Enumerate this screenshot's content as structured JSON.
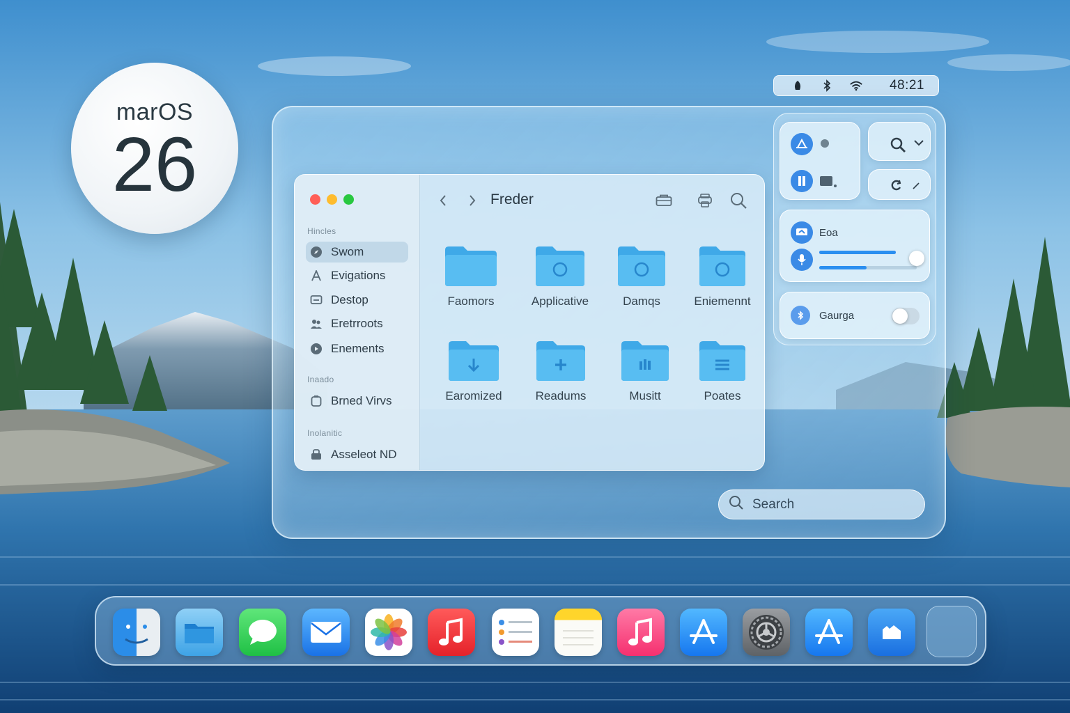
{
  "badge": {
    "title": "marOS",
    "version": "26"
  },
  "menubar": {
    "icons": [
      "focus-icon",
      "bluetooth-icon",
      "wifi-icon"
    ],
    "clock": "48:21"
  },
  "finder": {
    "title": "Freder",
    "sidebar": {
      "sections": [
        {
          "title": "Hincles",
          "items": [
            {
              "label": "Swom",
              "icon": "compass-icon",
              "active": true
            },
            {
              "label": "Evigations",
              "icon": "a-icon"
            },
            {
              "label": "Destop",
              "icon": "desktop-icon"
            },
            {
              "label": "Eretrroots",
              "icon": "people-icon"
            },
            {
              "label": "Enements",
              "icon": "clock-icon"
            }
          ]
        },
        {
          "title": "Inaado",
          "items": [
            {
              "label": "Brned Virvs",
              "icon": "drive-icon"
            }
          ]
        },
        {
          "title": "Inolanitic",
          "items": [
            {
              "label": "Asseleot ND",
              "icon": "network-icon"
            }
          ]
        }
      ]
    },
    "folders": [
      {
        "label": "Faomors",
        "glyph": "none"
      },
      {
        "label": "Applicative",
        "glyph": "circle"
      },
      {
        "label": "Damqs",
        "glyph": "circle"
      },
      {
        "label": "Eniemennt",
        "glyph": "circle"
      },
      {
        "label": "Earomized",
        "glyph": "download"
      },
      {
        "label": "Readums",
        "glyph": "plus"
      },
      {
        "label": "Musitt",
        "glyph": "bars"
      },
      {
        "label": "Poates",
        "glyph": "lines"
      }
    ]
  },
  "control_center": {
    "media": {
      "label": "Eoa",
      "level": 0.9
    },
    "toggle": {
      "label": "Gaurga",
      "on": false
    }
  },
  "search": {
    "placeholder": "Search"
  },
  "dock": {
    "apps": [
      "Finder",
      "Files",
      "Messages",
      "Mail",
      "Photos",
      "Music",
      "Reminders",
      "Notes",
      "iTunes",
      "App Store",
      "System Settings",
      "App Store",
      "Folder",
      "Empty"
    ]
  },
  "colors": {
    "accent": "#2a8ff0",
    "folder": "#4fb6ef"
  }
}
